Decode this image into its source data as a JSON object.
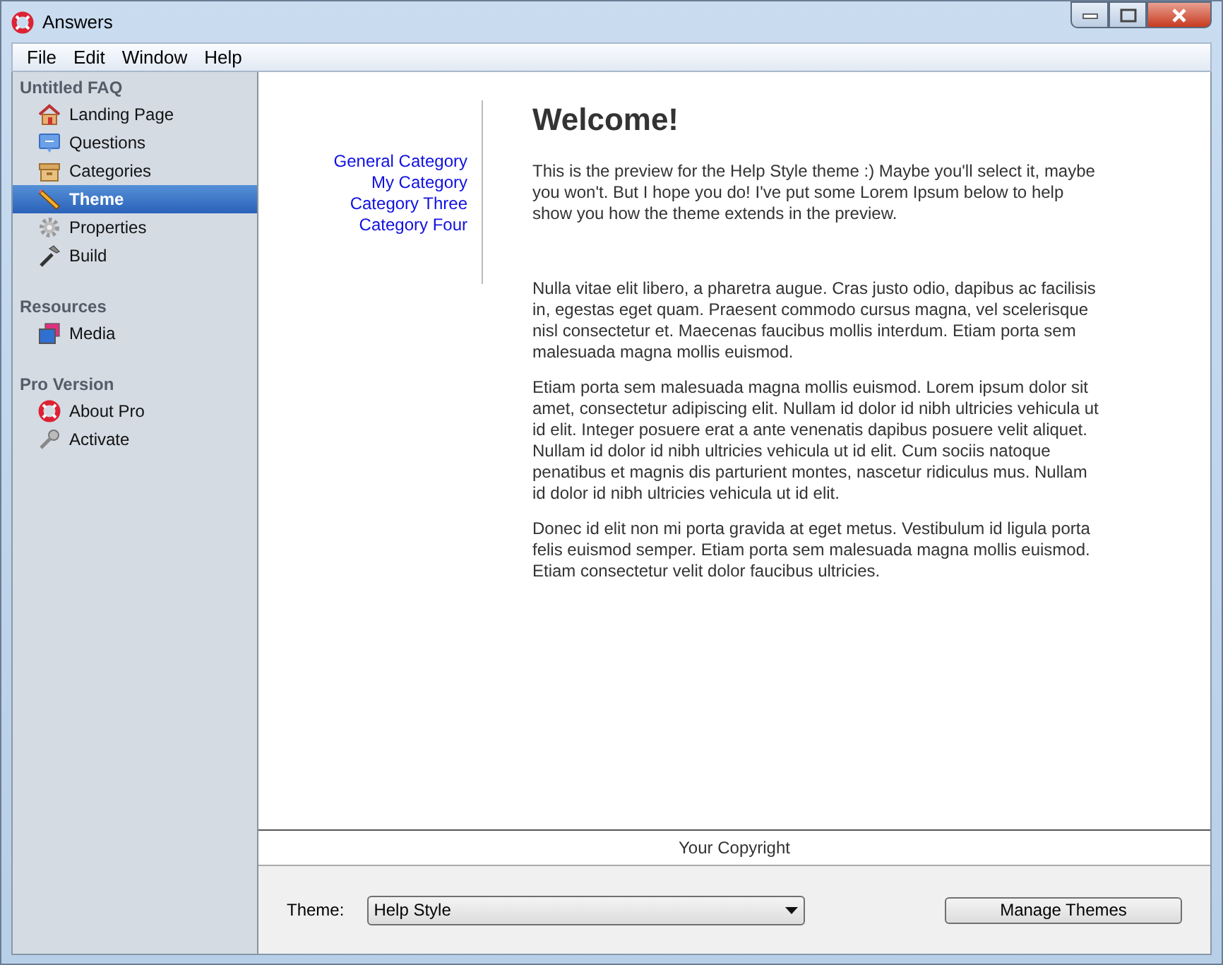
{
  "window": {
    "title": "Answers"
  },
  "menu": [
    "File",
    "Edit",
    "Window",
    "Help"
  ],
  "sidebar": {
    "sections": [
      {
        "title": "Untitled FAQ",
        "items": [
          {
            "label": "Landing Page",
            "selected": false
          },
          {
            "label": "Questions",
            "selected": false
          },
          {
            "label": "Categories",
            "selected": false
          },
          {
            "label": "Theme",
            "selected": true
          },
          {
            "label": "Properties",
            "selected": false
          },
          {
            "label": "Build",
            "selected": false
          }
        ]
      },
      {
        "title": "Resources",
        "items": [
          {
            "label": "Media",
            "selected": false
          }
        ]
      },
      {
        "title": "Pro Version",
        "items": [
          {
            "label": "About Pro",
            "selected": false
          },
          {
            "label": "Activate",
            "selected": false
          }
        ]
      }
    ]
  },
  "preview": {
    "categories": [
      "General Category",
      "My Category",
      "Category Three",
      "Category Four"
    ],
    "heading": "Welcome!",
    "intro": "This is the preview for the Help Style theme :) Maybe you'll select it, maybe you won't. But I hope you do! I've put some Lorem Ipsum below to help show you how the theme extends in the preview.",
    "paragraphs": [
      "Nulla vitae elit libero, a pharetra augue. Cras justo odio, dapibus ac facilisis in, egestas eget quam. Praesent commodo cursus magna, vel scelerisque nisl consectetur et. Maecenas faucibus mollis interdum. Etiam porta sem malesuada magna mollis euismod.",
      "Etiam porta sem malesuada magna mollis euismod. Lorem ipsum dolor sit amet, consectetur adipiscing elit. Nullam id dolor id nibh ultricies vehicula ut id elit. Integer posuere erat a ante venenatis dapibus posuere velit aliquet. Nullam id dolor id nibh ultricies vehicula ut id elit. Cum sociis natoque penatibus et magnis dis parturient montes, nascetur ridiculus mus. Nullam id dolor id nibh ultricies vehicula ut id elit.",
      "Donec id elit non mi porta gravida at eget metus. Vestibulum id ligula porta felis euismod semper. Etiam porta sem malesuada magna mollis euismod. Etiam consectetur velit dolor faucibus ultricies."
    ],
    "footer": "Your Copyright"
  },
  "bottom_bar": {
    "theme_label": "Theme:",
    "theme_value": "Help Style",
    "button": "Manage Themes"
  }
}
